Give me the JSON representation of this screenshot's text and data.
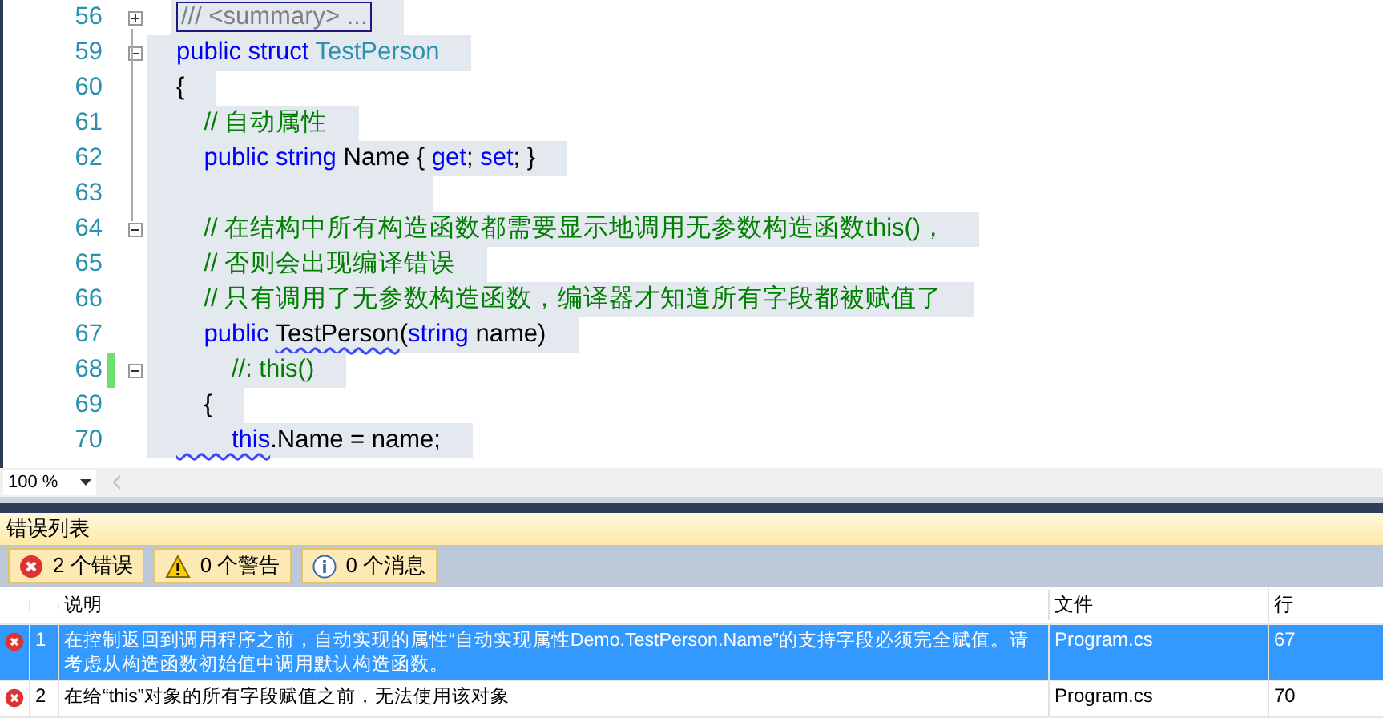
{
  "editor": {
    "lines": [
      {
        "number": "56",
        "foldable": true,
        "folded": true,
        "changed": false,
        "tokens": [
          {
            "kind": "collapsed",
            "text": "/// <summary> ..."
          }
        ]
      },
      {
        "number": "59",
        "foldable": true,
        "folded": false,
        "changed": false,
        "tokens": [
          {
            "kind": "keyword",
            "text": "public struct "
          },
          {
            "kind": "type",
            "text": "TestPerson"
          }
        ]
      },
      {
        "number": "60",
        "foldable": false,
        "changed": false,
        "tokens": [
          {
            "kind": "plain",
            "text": "{"
          }
        ]
      },
      {
        "number": "61",
        "foldable": false,
        "changed": false,
        "tokens": [
          {
            "kind": "comment",
            "text": "    // 自动属性"
          }
        ]
      },
      {
        "number": "62",
        "foldable": false,
        "changed": false,
        "tokens": [
          {
            "kind": "keyword",
            "text": "    public string "
          },
          {
            "kind": "plain",
            "text": "Name { "
          },
          {
            "kind": "keyword",
            "text": "get"
          },
          {
            "kind": "plain",
            "text": "; "
          },
          {
            "kind": "keyword",
            "text": "set"
          },
          {
            "kind": "plain",
            "text": "; }"
          }
        ]
      },
      {
        "number": "63",
        "foldable": false,
        "changed": false
      },
      {
        "number": "64",
        "foldable": true,
        "folded": false,
        "changed": false,
        "tokens": [
          {
            "kind": "comment",
            "text": "    // 在结构中所有构造函数都需要显示地调用无参数构造函数this()，"
          }
        ]
      },
      {
        "number": "65",
        "foldable": false,
        "changed": false,
        "tokens": [
          {
            "kind": "comment",
            "text": "    // 否则会出现编译错误"
          }
        ]
      },
      {
        "number": "66",
        "foldable": false,
        "changed": false,
        "tokens": [
          {
            "kind": "comment",
            "text": "    // 只有调用了无参数构造函数，编译器才知道所有字段都被赋值了"
          }
        ]
      },
      {
        "number": "67",
        "foldable": false,
        "changed": false,
        "tokens": [
          {
            "kind": "keyword",
            "text": "    public "
          },
          {
            "kind": "error",
            "text": "TestPerson"
          },
          {
            "kind": "plain",
            "text": "("
          },
          {
            "kind": "keyword",
            "text": "string "
          },
          {
            "kind": "plain",
            "text": "name)"
          }
        ]
      },
      {
        "number": "68",
        "foldable": true,
        "folded": false,
        "changed": true,
        "tokens": [
          {
            "kind": "comment",
            "text": "        //: this()"
          }
        ]
      },
      {
        "number": "69",
        "foldable": false,
        "changed": false,
        "tokens": [
          {
            "kind": "plain",
            "text": "    {"
          }
        ]
      },
      {
        "number": "70",
        "foldable": false,
        "changed": false,
        "tokens": [
          {
            "kind": "keyword-error",
            "text": "        this"
          },
          {
            "kind": "plain",
            "text": ".Name = name;"
          }
        ]
      }
    ],
    "zoom": "100 %"
  },
  "error_list": {
    "title": "错误列表",
    "filters": [
      {
        "kind": "error",
        "label": "2 个错误",
        "selected": true
      },
      {
        "kind": "warning",
        "label": "0 个警告",
        "selected": true
      },
      {
        "kind": "info",
        "label": "0 个消息",
        "selected": true
      }
    ],
    "columns": [
      "说明",
      "文件",
      "行"
    ],
    "rows": [
      {
        "number": "1",
        "description": "在控制返回到调用程序之前，自动实现的属性“自动实现属性Demo.TestPerson.Name”的支持字段必须完全赋值。请考虑从构造函数初始值中调用默认构造函数。",
        "file": "Program.cs",
        "line": "67",
        "selected": true
      },
      {
        "number": "2",
        "description": "在给“this”对象的所有字段赋值之前，无法使用该对象",
        "file": "Program.cs",
        "line": "70",
        "selected": false
      }
    ]
  }
}
